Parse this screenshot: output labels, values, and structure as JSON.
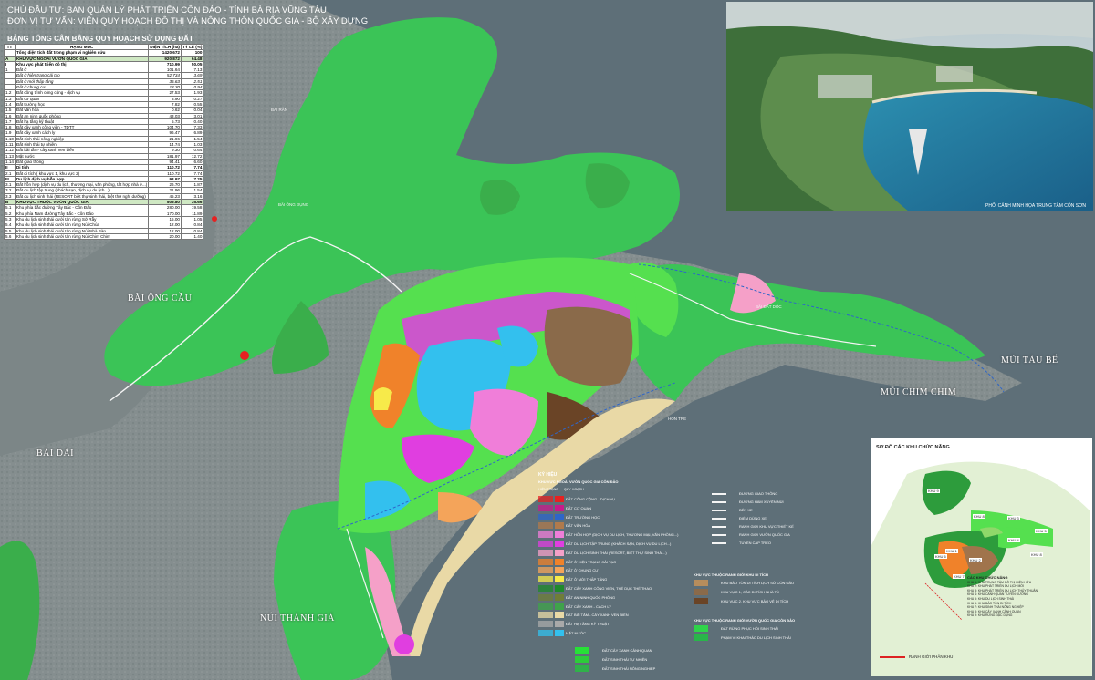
{
  "header": {
    "line1": "CHỦ ĐẦU TƯ:    BAN QUẢN LÝ PHÁT TRIỂN CÔN ĐẢO - TỈNH BÀ RỊA VŨNG TÀU",
    "line2": "ĐƠN VỊ TƯ VẤN: VIỆN QUY HOẠCH ĐÔ THỊ VÀ NÔNG THÔN QUỐC GIA - BỘ XÂY DỰNG"
  },
  "table": {
    "title": "BẢNG TỔNG CÂN BẰNG QUY HOẠCH SỬ DỤNG ĐẤT",
    "headers": [
      "TT",
      "HẠNG MỤC",
      "DIỆN TÍCH (ha)",
      "TỶ LỆ (%)"
    ],
    "rows": [
      [
        "",
        "Tổng diện tích đất trong phạm vi nghiên cứu",
        "1420.672",
        "100"
      ],
      [
        "A",
        "KHU VỰC NGOÀI VƯỜN QUỐC GIA",
        "920.872",
        "64.48"
      ],
      [
        "I",
        "Khu vực phát triển đô thị",
        "710.99",
        "50.05"
      ],
      [
        "1",
        "Đất ở",
        "101.64",
        "7.13"
      ],
      [
        "",
        "Đất ở hiện trạng cải tạo",
        "52.734",
        "3.69"
      ],
      [
        "",
        "Đất ở mới thấp tầng",
        "35.63",
        "2.51"
      ],
      [
        "",
        "Đất ở chung cư",
        "13.30",
        "0.94"
      ],
      [
        "1.2",
        "Đất công trình công cộng - dịch vụ",
        "27.53",
        "1.93"
      ],
      [
        "1.3",
        "Đất cơ quan",
        "3.90",
        "0.27"
      ],
      [
        "1.4",
        "Đất trường học",
        "7.82",
        "0.55"
      ],
      [
        "1.5",
        "Đất văn hóa",
        "0.62",
        "0.04"
      ],
      [
        "1.6",
        "Đất an ninh quốc phòng",
        "43.03",
        "3.01"
      ],
      [
        "1.7",
        "Đất hạ tầng kỹ thuật",
        "5.73",
        "0.40"
      ],
      [
        "1.8",
        "Đất cây xanh công viên - TDTT",
        "104.70",
        "7.33"
      ],
      [
        "1.9",
        "Đất cây xanh cách ly",
        "96.47",
        "6.89"
      ],
      [
        "1.10",
        "Đất sinh thái nông nghiệp",
        "21.96",
        "1.54"
      ],
      [
        "1.11",
        "Đất sinh thái tự nhiên",
        "14.74",
        "1.03"
      ],
      [
        "1.12",
        "Đất bãi tắm- cây xanh ven biển",
        "9.30",
        "0.64"
      ],
      [
        "1.13",
        "Mặt nước",
        "181.97",
        "12.72"
      ],
      [
        "1.14",
        "Đất giao thông",
        "94.41",
        "6.60"
      ],
      [
        "II",
        "Di tích",
        "110.72",
        "7.74"
      ],
      [
        "2.1",
        "Đất di tích ( khu vực 1, khu vực 2)",
        "110.72",
        "7.74"
      ],
      [
        "III",
        "Du lịch dịch vụ hỗn hợp",
        "93.97",
        "7.25"
      ],
      [
        "3.1",
        "Đất hỗn hợp (dịch vụ du lịch, thương mại, văn phòng, tất hợp nhà ở...)",
        "26.70",
        "1.87"
      ],
      [
        "3.2",
        "Đất du lịch tập trung (khách sạn, dịch vụ du lịch...)",
        "21.96",
        "1.54"
      ],
      [
        "3.3",
        "Đất du lịch sinh thái (RESORT biệt thự sinh thái, biệt thự nghỉ dưỡng)",
        "45.23",
        "3.16"
      ],
      [
        "B",
        "KHU VỰC THUỘC VƯỜN QUỐC GIA",
        "509.80",
        "35.66"
      ],
      [
        "5.1",
        "Khu phía bắc đường Tây Bắc - Côn Đảo",
        "280.00",
        "19.58"
      ],
      [
        "5.2",
        "Khu phía Nam đường Tây Bắc - Côn Đảo",
        "170.00",
        "11.89"
      ],
      [
        "5.3",
        "Khu du lịch sinh thái dưới tán rừng Sở Rẫy",
        "15.00",
        "1.05"
      ],
      [
        "5.4",
        "Khu du lịch sinh thái dưới tán rừng Núi Chúa",
        "12.00",
        "0.84"
      ],
      [
        "5.5",
        "Khu du lịch sinh thái dưới tán rừng Núi Nhà Bàn",
        "12.00",
        "0.84"
      ],
      [
        "5.6",
        "Khu du lịch sinh thái dưới tán rừng Núi Chim Chim",
        "20.00",
        "1.40"
      ]
    ]
  },
  "photo": {
    "caption": "PHỐI CẢNH MINH HỌA TRUNG TÂM CÔN SƠN"
  },
  "places": {
    "bai_ong_cau": "BÃI ÔNG CẦU",
    "bai_dai": "BÃI DÀI",
    "nui_thanh_gia": "NÚI THÁNH GIÁ",
    "mui_tau_be": "MŨI TÀU BỂ",
    "mui_chim_chim": "MŨI CHIM CHIM",
    "bai_ong_dung": "BÃI ÔNG ĐỤNG",
    "bai_ran": "BÃI RẪN",
    "bai_dat_doc": "BÃI ĐẤT DỐC",
    "hon_tre": "HÒN TRE"
  },
  "legend": {
    "title": "KÝ HIỆU",
    "subtitle": "KHU VỰC NGOÀI VƯỜN QUỐC GIA CÔN ĐẢO",
    "col_hien_trang": "HIỆN TRẠNG",
    "col_quy_hoach": "QUY HOẠCH",
    "items": [
      {
        "color": "#e52222",
        "label": "ĐẤT CÔNG CỘNG - DỊCH VỤ"
      },
      {
        "color": "#c81a8c",
        "label": "ĐẤT CƠ QUAN"
      },
      {
        "color": "#2e66c9",
        "label": "ĐẤT TRƯỜNG HỌC"
      },
      {
        "color": "#b07a4c",
        "label": "ĐẤT VĂN HÓA"
      },
      {
        "color": "#f07ed9",
        "label": "ĐẤT HỖN HỢP (DỊCH VỤ DU LỊCH, THƯƠNG MẠI, VĂN PHÒNG...)"
      },
      {
        "color": "#e03ee0",
        "label": "ĐẤT DU LỊCH TẬP TRUNG (KHÁCH SẠN, DỊCH VỤ DU LỊCH...)"
      },
      {
        "color": "#f5a0c8",
        "label": "ĐẤT DU LỊCH SINH THÁI (RESORT, BIỆT THỰ SINH THÁI...)"
      },
      {
        "color": "#f0822a",
        "label": "ĐẤT Ở HIỆN TRẠNG CẢI TẠO"
      },
      {
        "color": "#f4a45a",
        "label": "ĐẤT Ở CHUNG CƯ"
      },
      {
        "color": "#f7ea4a",
        "label": "ĐẤT Ở MỚI THẤP TẦNG"
      },
      {
        "color": "#1f8a2b",
        "label": "ĐẤT CÂY XANH CÔNG VIÊN, THỂ DỤC THỂ THAO"
      },
      {
        "color": "#6f7d38",
        "label": "ĐẤT AN NINH QUỐC PHÒNG"
      },
      {
        "color": "#3fa34a",
        "label": "ĐẤT CÂY XANH - CÁCH LY"
      },
      {
        "color": "#e9d9a6",
        "label": "ĐẤT BÃI TẮM - CÂY XANH VEN BIỂN"
      },
      {
        "color": "#a9a9a9",
        "label": "ĐẤT HẠ TẦNG KỸ THUẬT"
      },
      {
        "color": "#33c0ee",
        "label": "MẶT NƯỚC"
      }
    ],
    "right_items": [
      {
        "label": "ĐƯỜNG GIAO THÔNG"
      },
      {
        "label": "ĐƯỜNG HẦM XUYÊN NÚI"
      },
      {
        "label": "BẾN XE"
      },
      {
        "label": "ĐIỂM DỪNG XE"
      },
      {
        "label": "RANH GIỚI KHU VỰC THIẾT KẾ"
      },
      {
        "label": "RANH GIỚI VƯỜN QUỐC GIA"
      },
      {
        "label": "TUYẾN CÁP TREO"
      }
    ],
    "relic_title": "KHU VỰC THUỘC RANH GIỚI KHU DI TÍCH",
    "relic_items": [
      {
        "color": "#b78d5c",
        "label": "KHU BẢO TỒN DI TÍCH LỊCH SỬ CÔN ĐẢO"
      },
      {
        "color": "#8a6a4a",
        "label": "KHU VỰC 1, CÁC DI TÍCH NHÀ TÙ"
      },
      {
        "color": "#6a4426",
        "label": "KHU VỰC 2, KHU VỰC BẢO VỆ DI TÍCH"
      }
    ],
    "np_title": "KHU VỰC THUỘC RANH GIỚI VƯỜN QUỐC GIA CÔN ĐẢO",
    "np_items": [
      {
        "color": "#2fd44a",
        "label": "ĐẤT RỪNG PHỤC HỒI SINH THÁI"
      },
      {
        "color": "#29b54a",
        "label": "PHẠM VI KHAI THÁC DU LỊCH SINH THÁI"
      }
    ],
    "bottom_items": [
      {
        "color": "#27e037",
        "label": "ĐẤT CÂY XANH CẢNH QUAN"
      },
      {
        "color": "#2dcc3a",
        "label": "ĐẤT SINH THÁI TỰ NHIÊN"
      },
      {
        "color": "#30b14a",
        "label": "ĐẤT SINH THÁI NÔNG NGHIỆP"
      }
    ]
  },
  "inset": {
    "title": "SƠ ĐỒ CÁC KHU CHỨC NĂNG",
    "legend_title": "CÁC KHU CHỨC NĂNG",
    "legend_items": [
      "KHU 1: KHU TRUNG TÂM ĐÔ THỊ HIỆN HỮU",
      "KHU 2: KHU PHÁT TRIỂN DU LỊCH MỚI",
      "KHU 3: KHU PHÁT TRIỂN DU LỊCH THỦY THUẬN",
      "KHU 4: KHU CẢNH QUAN TUYẾN ĐƯỜNG",
      "KHU 5: KHU DU LỊCH SINH THÁI",
      "KHU 6: KHU BẢO TỒN DI TÍCH",
      "KHU 7: KHU SINH THÁI NÔNG NGHIỆP",
      "KHU 8: KHU CÂY XANH CẢNH QUAN",
      "KHU 9: KHU RỪNG ĐẶC DỤNG"
    ],
    "boundary_label": "RANH GIỚI PHÂN KHU",
    "zones": [
      "KHU 9",
      "KHU 6",
      "KHU 8",
      "KHU 3",
      "KHU 5",
      "KHU 7",
      "KHU 1",
      "KHU 2",
      "KHU 4",
      "KHU 8"
    ]
  },
  "colors": {
    "sea": "#5e6f78",
    "hills": "#8a9394",
    "forest": "#3bc457",
    "forest_light": "#55e04f",
    "water": "#33c0ee",
    "boundary": "#e52222"
  }
}
